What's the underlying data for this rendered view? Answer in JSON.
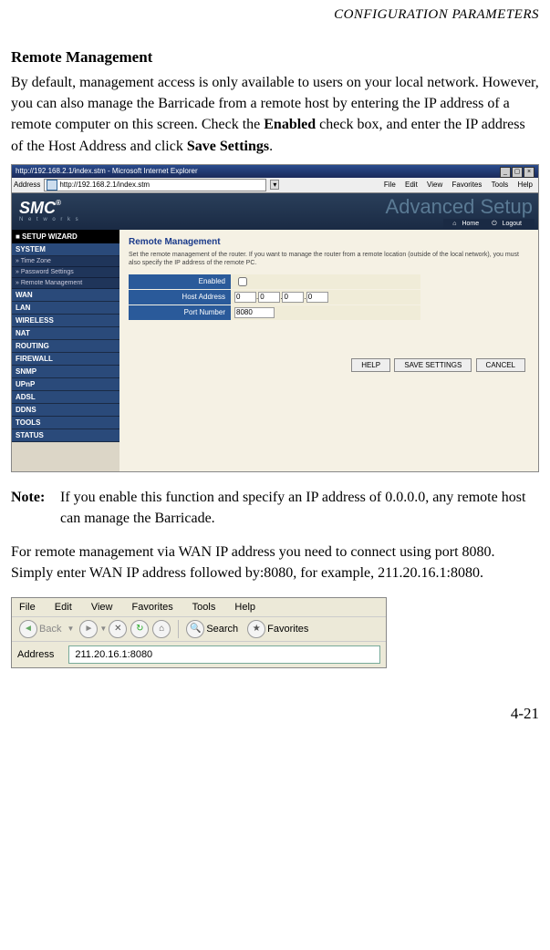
{
  "header": "CONFIGURATION PARAMETERS",
  "section_title": "Remote Management",
  "para1_a": "By default, management access is only available to users on your local network. However, you can also manage the Barricade from a remote host by entering the IP address of a remote computer on this screen. Check the ",
  "para1_b": "Enabled",
  "para1_c": " check box, and enter the IP address of the Host Address and click ",
  "para1_d": "Save Settings",
  "para1_e": ".",
  "fig1": {
    "title": "http://192.168.2.1/index.stm - Microsoft Internet Explorer",
    "address_label": "Address",
    "url": "http://192.168.2.1/index.stm",
    "menus": [
      "File",
      "Edit",
      "View",
      "Favorites",
      "Tools",
      "Help"
    ],
    "brand": "SMC",
    "brand_sub": "N e t w o r k s",
    "adv": "Advanced Setup",
    "home": "Home",
    "logout": "Logout",
    "wizard": "■ SETUP WIZARD",
    "sidebar_heads": [
      "SYSTEM",
      "WAN",
      "LAN",
      "WIRELESS",
      "NAT",
      "ROUTING",
      "FIREWALL",
      "SNMP",
      "UPnP",
      "ADSL",
      "DDNS",
      "TOOLS",
      "STATUS"
    ],
    "sidebar_subs": [
      "» Time Zone",
      "» Password Settings",
      "» Remote Management"
    ],
    "content_title": "Remote Management",
    "content_desc": "Set the remote management of the router. If you want to manage the router from a remote location (outside of the local network), you must also specify the IP address of the remote PC.",
    "lbl_enabled": "Enabled",
    "lbl_host": "Host Address",
    "lbl_port": "Port Number",
    "ip": [
      "0",
      "0",
      "0",
      "0"
    ],
    "port": "8080",
    "btn_help": "HELP",
    "btn_save": "SAVE SETTINGS",
    "btn_cancel": "CANCEL"
  },
  "note_label": "Note:",
  "note_text": "If you enable this function and specify an IP address of 0.0.0.0, any remote host can manage the Barricade.",
  "para2": "For remote management via WAN IP address you need to connect using port 8080. Simply enter WAN IP address followed by:8080, for example, 211.20.16.1:8080.",
  "fig2": {
    "menus": [
      "File",
      "Edit",
      "View",
      "Favorites",
      "Tools",
      "Help"
    ],
    "back": "Back",
    "search": "Search",
    "fav": "Favorites",
    "address_label": "Address",
    "url": "211.20.16.1:8080"
  },
  "page_num": "4-21"
}
